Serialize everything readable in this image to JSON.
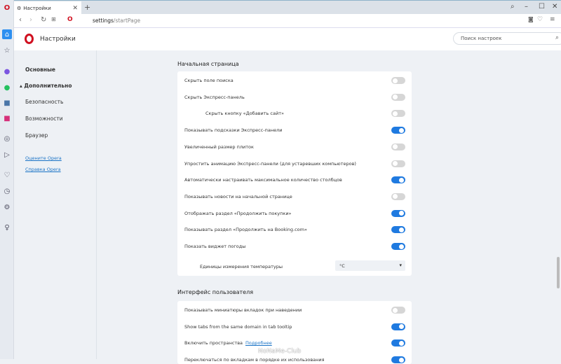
{
  "tab": {
    "title": "Настройки"
  },
  "address": {
    "host": "settings",
    "path": "/startPage"
  },
  "header": {
    "title": "Настройки",
    "search_placeholder": "Поиск настроек"
  },
  "nav": {
    "items": [
      "Основные",
      "Дополнительно",
      "Безопасность",
      "Возможности",
      "Браузер"
    ],
    "links": [
      "Оцените Opera",
      "Справка Opera"
    ]
  },
  "section1": {
    "title": "Начальная страница",
    "rows": [
      {
        "label": "Скрыть поле поиска",
        "on": false
      },
      {
        "label": "Скрыть Экспресс-панель",
        "on": false
      },
      {
        "label": "Скрыть кнопку «Добавить сайт»",
        "on": false,
        "indent": true
      },
      {
        "label": "Показывать подсказки Экспресс-панели",
        "on": true
      },
      {
        "label": "Увеличенный размер плиток",
        "on": false
      },
      {
        "label": "Упростить анимацию Экспресс-панели (для устаревших компьютеров)",
        "on": false
      },
      {
        "label": "Автоматически настраивать максимальное количество столбцов",
        "on": true
      },
      {
        "label": "Показывать новости на начальной странице",
        "on": false
      },
      {
        "label": "Отображать раздел «Продолжить покупки»",
        "on": true
      },
      {
        "label": "Показывать раздел «Продолжить на Booking.com»",
        "on": true
      },
      {
        "label": "Показать виджет погоды",
        "on": true
      }
    ],
    "temp_label": "Единицы измерения температуры",
    "temp_value": "°C"
  },
  "section2": {
    "title": "Интерфейс пользователя",
    "rows": [
      {
        "label": "Показывать миниатюры вкладок при наведении",
        "on": false
      },
      {
        "label": "Show tabs from the same domain in tab tooltip",
        "on": true
      },
      {
        "label": "Включить пространства",
        "on": true,
        "link": "Подробнее"
      },
      {
        "label": "Переключаться по вкладкам в порядке их использования",
        "on": true
      }
    ]
  },
  "watermark": "NoNaMe-Club"
}
